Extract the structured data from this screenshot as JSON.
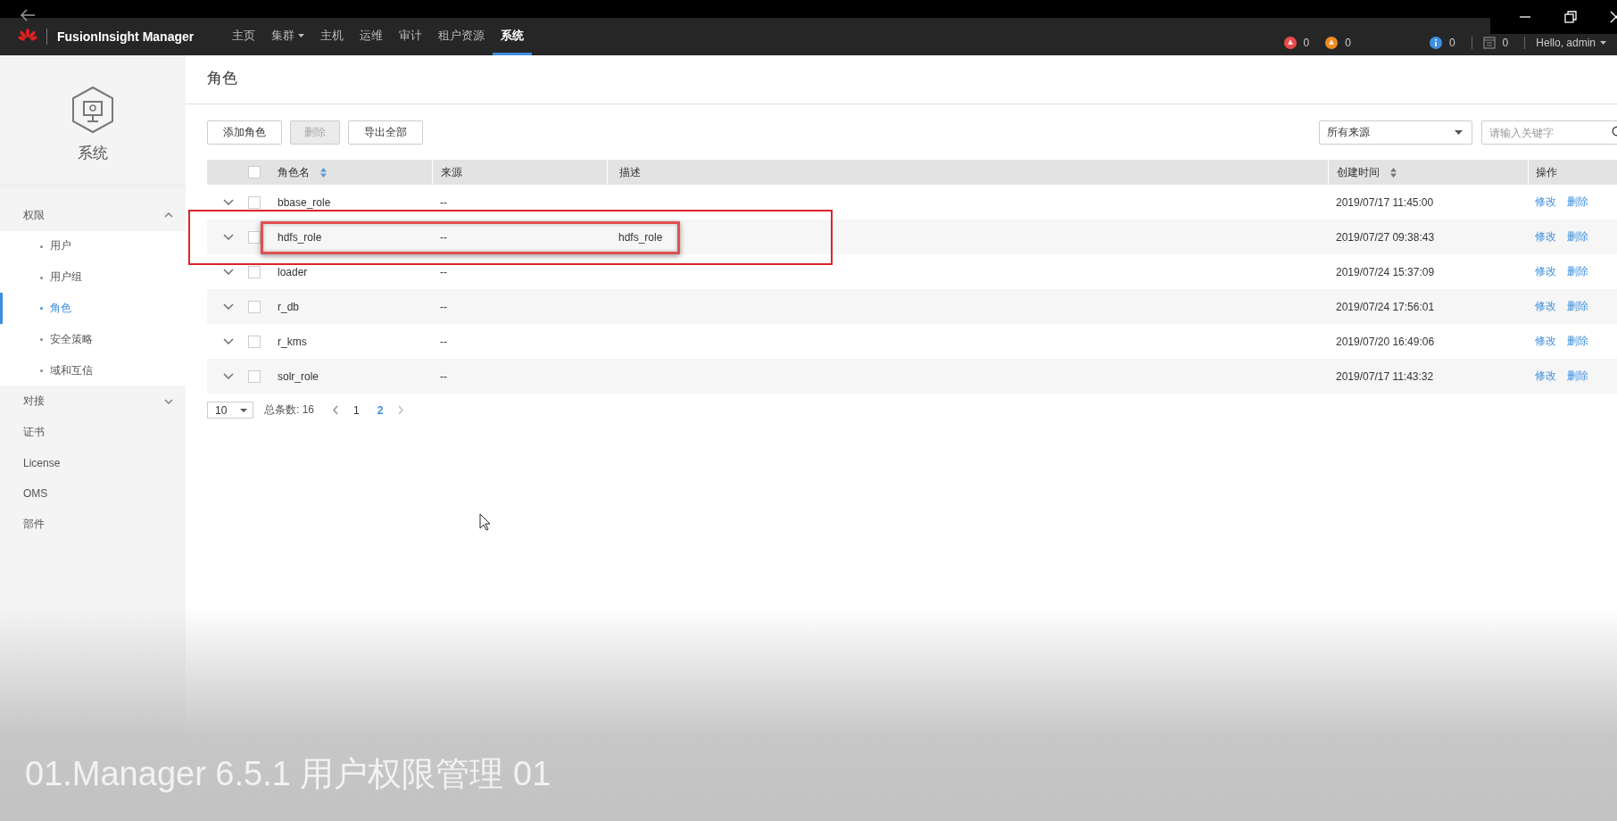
{
  "nav": {
    "brand": "FusionInsight Manager",
    "items": [
      {
        "label": "主页",
        "dropdown": false,
        "selected": false
      },
      {
        "label": "集群",
        "dropdown": true,
        "selected": false
      },
      {
        "label": "主机",
        "dropdown": false,
        "selected": false
      },
      {
        "label": "运维",
        "dropdown": false,
        "selected": false
      },
      {
        "label": "审计",
        "dropdown": false,
        "selected": false
      },
      {
        "label": "租户资源",
        "dropdown": false,
        "selected": false
      },
      {
        "label": "系统",
        "dropdown": false,
        "selected": true
      }
    ],
    "indicators": [
      {
        "kind": "critical",
        "count": "0"
      },
      {
        "kind": "major",
        "count": "0"
      },
      {
        "kind": "info",
        "count": "0"
      },
      {
        "kind": "tasks",
        "count": "0"
      }
    ],
    "user_menu": "Hello, admin"
  },
  "sidebar": {
    "title": "系统",
    "groups": [
      {
        "label": "权限",
        "expanded": true,
        "children": [
          {
            "label": "用户",
            "selected": false
          },
          {
            "label": "用户组",
            "selected": false
          },
          {
            "label": "角色",
            "selected": true
          },
          {
            "label": "安全策略",
            "selected": false
          },
          {
            "label": "域和互信",
            "selected": false
          }
        ]
      },
      {
        "label": "对接",
        "expanded": false
      },
      {
        "label": "证书"
      },
      {
        "label": "License"
      },
      {
        "label": "OMS"
      },
      {
        "label": "部件"
      }
    ]
  },
  "page": {
    "title": "角色",
    "buttons": [
      {
        "label": "添加角色",
        "disabled": false
      },
      {
        "label": "删除",
        "disabled": true
      },
      {
        "label": "导出全部",
        "disabled": false
      }
    ],
    "filter": {
      "value": "所有来源"
    },
    "search": {
      "placeholder": "请输入关键字"
    },
    "table": {
      "header_checked": false,
      "columns": [
        {
          "label": "角色名",
          "sortable": true
        },
        {
          "label": "来源",
          "sortable": false
        },
        {
          "label": "描述",
          "sortable": false
        },
        {
          "label": "创建时间",
          "sortable": true
        },
        {
          "label": "操作",
          "sortable": false
        }
      ],
      "rows": [
        {
          "name": "bbase_role",
          "source": "--",
          "created": "2019/07/17 11:45:00",
          "actions": [
            "修改",
            "删除"
          ],
          "checked": false,
          "annotated": false
        },
        {
          "name": "hdfs_role",
          "source": "--",
          "description": "hdfs_role",
          "created": "2019/07/27 09:38:43",
          "actions": [
            "修改",
            "删除"
          ],
          "checked": false,
          "annotated": true
        },
        {
          "name": "loader",
          "source": "--",
          "created": "2019/07/24 15:37:09",
          "actions": [
            "修改",
            "删除"
          ],
          "checked": false,
          "annotated": false
        },
        {
          "name": "r_db",
          "source": "--",
          "created": "2019/07/24 17:56:01",
          "actions": [
            "修改",
            "删除"
          ],
          "checked": false,
          "annotated": false
        },
        {
          "name": "r_kms",
          "source": "--",
          "created": "2019/07/20 16:49:06",
          "actions": [
            "修改",
            "删除"
          ],
          "checked": false,
          "annotated": false
        },
        {
          "name": "solr_role",
          "source": "--",
          "created": "2019/07/17 11:43:32",
          "actions": [
            "修改",
            "删除"
          ],
          "checked": false,
          "annotated": false
        }
      ]
    },
    "pagination": {
      "page_size": "10",
      "total": "总条数: 16",
      "pages": [
        {
          "label": "1",
          "selected": false
        },
        {
          "label": "2",
          "selected": true
        }
      ]
    }
  },
  "video_caption": "01.Manager 6.5.1 用户权限管理 01"
}
